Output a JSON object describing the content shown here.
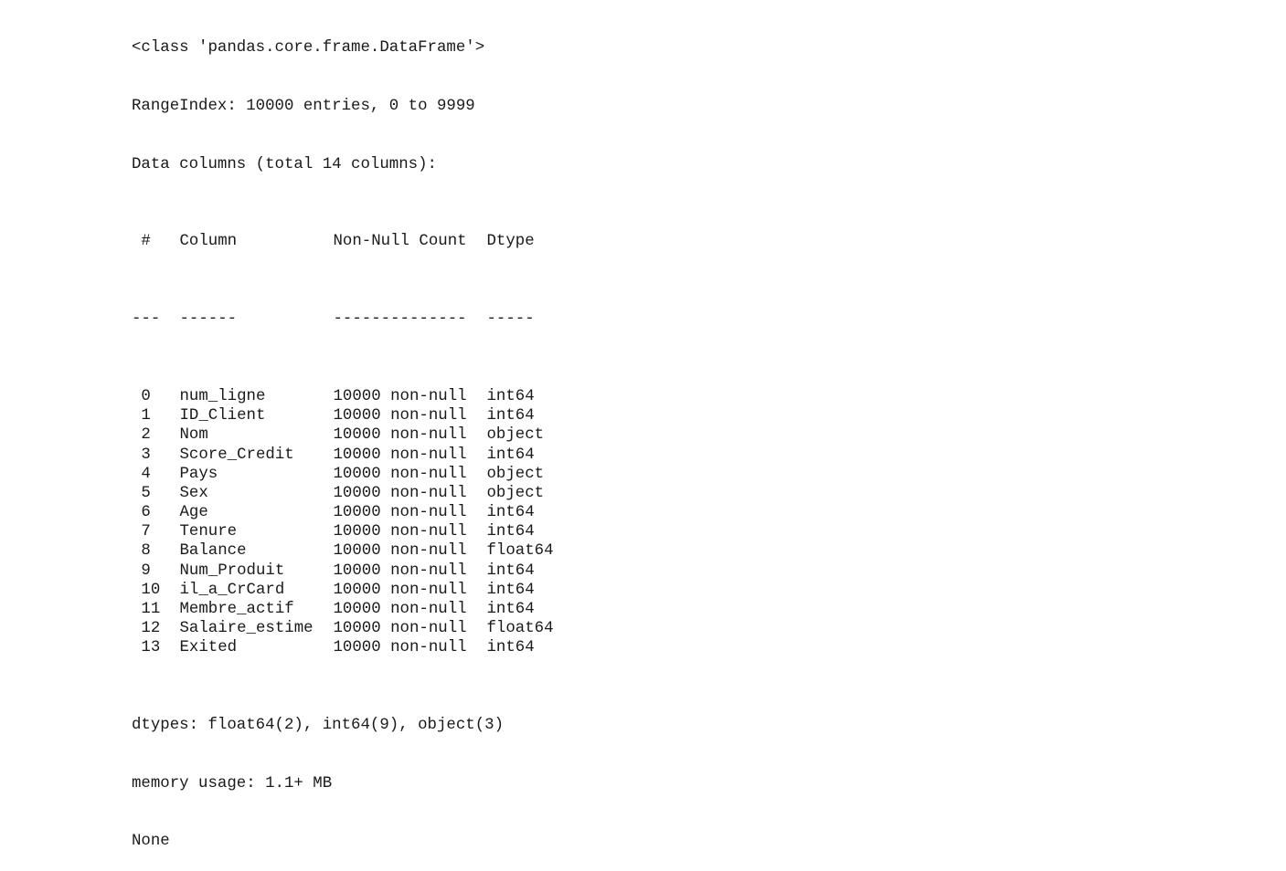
{
  "header": {
    "class_line": "<class 'pandas.core.frame.DataFrame'>",
    "range_line": "RangeIndex: 10000 entries, 0 to 9999",
    "columns_line": "Data columns (total 14 columns):"
  },
  "table": {
    "headers": [
      " #",
      "Column",
      "Non-Null Count",
      "Dtype"
    ],
    "separators": [
      "---",
      "------",
      "--------------",
      "-----"
    ],
    "rows": [
      {
        "idx": " 0",
        "name": "num_ligne",
        "count": "10000 non-null",
        "dtype": "int64"
      },
      {
        "idx": " 1",
        "name": "ID_Client",
        "count": "10000 non-null",
        "dtype": "int64"
      },
      {
        "idx": " 2",
        "name": "Nom",
        "count": "10000 non-null",
        "dtype": "object"
      },
      {
        "idx": " 3",
        "name": "Score_Credit",
        "count": "10000 non-null",
        "dtype": "int64"
      },
      {
        "idx": " 4",
        "name": "Pays",
        "count": "10000 non-null",
        "dtype": "object"
      },
      {
        "idx": " 5",
        "name": "Sex",
        "count": "10000 non-null",
        "dtype": "object"
      },
      {
        "idx": " 6",
        "name": "Age",
        "count": "10000 non-null",
        "dtype": "int64"
      },
      {
        "idx": " 7",
        "name": "Tenure",
        "count": "10000 non-null",
        "dtype": "int64"
      },
      {
        "idx": " 8",
        "name": "Balance",
        "count": "10000 non-null",
        "dtype": "float64"
      },
      {
        "idx": " 9",
        "name": "Num_Produit",
        "count": "10000 non-null",
        "dtype": "int64"
      },
      {
        "idx": " 10",
        "name": "il_a_CrCard",
        "count": "10000 non-null",
        "dtype": "int64"
      },
      {
        "idx": " 11",
        "name": "Membre_actif",
        "count": "10000 non-null",
        "dtype": "int64"
      },
      {
        "idx": " 12",
        "name": "Salaire_estime",
        "count": "10000 non-null",
        "dtype": "float64"
      },
      {
        "idx": " 13",
        "name": "Exited",
        "count": "10000 non-null",
        "dtype": "int64"
      }
    ]
  },
  "footer": {
    "dtypes_line": "dtypes: float64(2), int64(9), object(3)",
    "memory_line": "memory usage: 1.1+ MB",
    "return_line": "None"
  }
}
